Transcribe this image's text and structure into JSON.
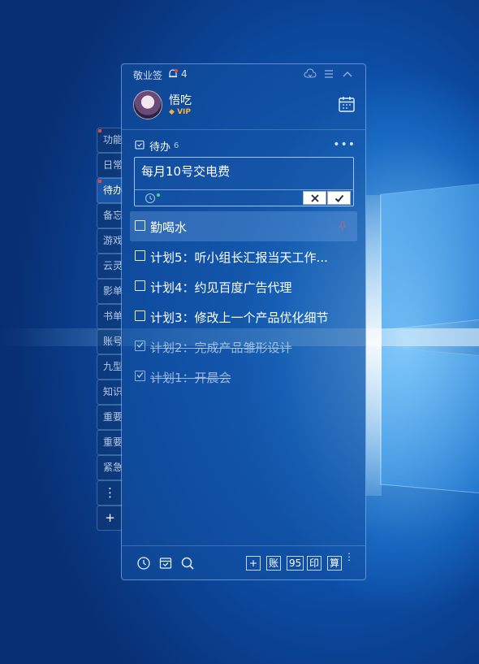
{
  "app": {
    "name": "敬业签",
    "notification_count": "4"
  },
  "user": {
    "name": "悟吃",
    "badge": "VIP"
  },
  "side_tabs": [
    {
      "label": "功能",
      "flagged": true,
      "active": false
    },
    {
      "label": "日常",
      "flagged": false,
      "active": false
    },
    {
      "label": "待办",
      "flagged": true,
      "active": true
    },
    {
      "label": "备忘",
      "flagged": false,
      "active": false
    },
    {
      "label": "游戏",
      "flagged": false,
      "active": false
    },
    {
      "label": "云灵",
      "flagged": false,
      "active": false
    },
    {
      "label": "影单",
      "flagged": false,
      "active": false
    },
    {
      "label": "书单",
      "flagged": false,
      "active": false
    },
    {
      "label": "账号",
      "flagged": false,
      "active": false
    },
    {
      "label": "九型",
      "flagged": false,
      "active": false
    },
    {
      "label": "知识",
      "flagged": false,
      "active": false
    },
    {
      "label": "重要",
      "flagged": false,
      "active": false
    },
    {
      "label": "重要",
      "flagged": false,
      "active": false
    },
    {
      "label": "紧急",
      "flagged": false,
      "active": false
    }
  ],
  "side_tools": {
    "more": "⋮",
    "add": "+"
  },
  "section": {
    "title": "待办",
    "count": "6",
    "more": "•••"
  },
  "editor": {
    "value": "每月10号交电费"
  },
  "todos": [
    {
      "text": "勤喝水",
      "done": false,
      "highlight": true
    },
    {
      "text": "计划5：听小组长汇报当天工作...",
      "done": false,
      "highlight": false
    },
    {
      "text": "计划4：约见百度广告代理",
      "done": false,
      "highlight": false
    },
    {
      "text": "计划3：修改上一个产品优化细节",
      "done": false,
      "highlight": false
    },
    {
      "text": "计划2：完成产品雏形设计",
      "done": true,
      "highlight": false
    },
    {
      "text": "计划1：开晨会",
      "done": true,
      "highlight": false
    }
  ],
  "footer": {
    "buttons": [
      "+",
      "账",
      "95",
      "印",
      "算"
    ],
    "more": "⋮"
  },
  "colors": {
    "accent": "#1e5aa8",
    "flag": "#e8463c",
    "vip": "#f3b13f",
    "dot": "#3ee07a"
  }
}
